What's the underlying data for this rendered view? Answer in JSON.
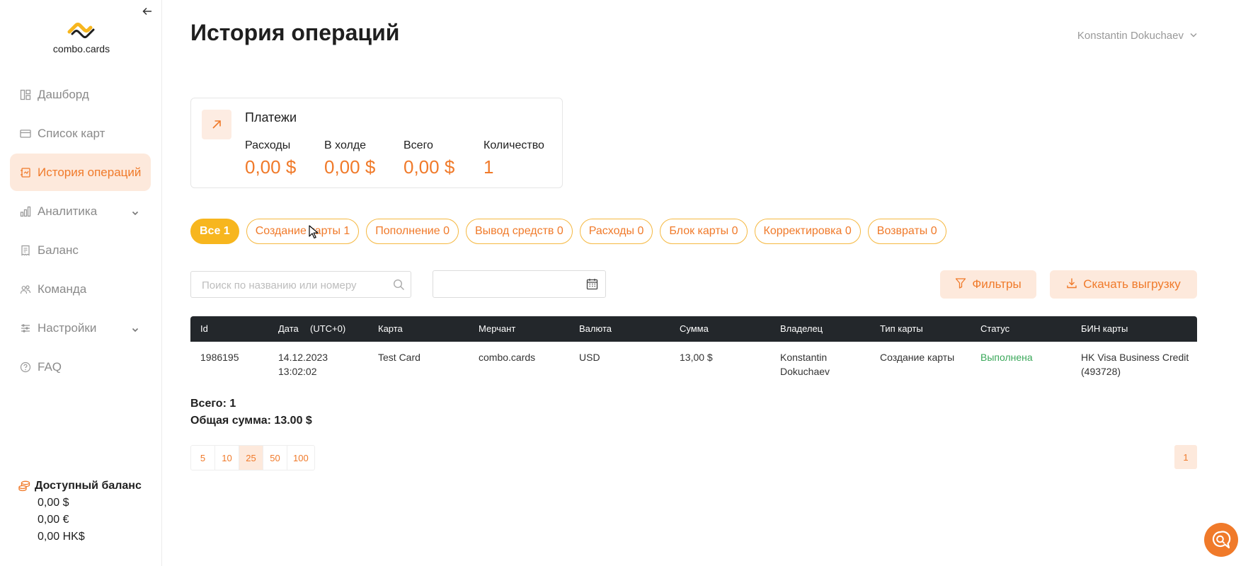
{
  "app": {
    "logo_text": "combo.cards"
  },
  "sidebar": {
    "items": [
      {
        "label": "Дашборд",
        "icon": "dashboard-icon"
      },
      {
        "label": "Список карт",
        "icon": "card-icon"
      },
      {
        "label": "История операций",
        "icon": "history-icon",
        "active": true
      },
      {
        "label": "Аналитика",
        "icon": "analytics-icon",
        "expandable": true
      },
      {
        "label": "Баланс",
        "icon": "receipt-icon"
      },
      {
        "label": "Команда",
        "icon": "team-icon"
      },
      {
        "label": "Настройки",
        "icon": "settings-icon",
        "expandable": true
      },
      {
        "label": "FAQ",
        "icon": "question-icon"
      }
    ],
    "balance": {
      "title": "Доступный баланс",
      "lines": [
        "0,00 $",
        "0,00 €",
        "0,00 HK$"
      ]
    }
  },
  "header": {
    "title": "История операций",
    "user": "Konstantin Dokuchaev"
  },
  "summary_card": {
    "title": "Платежи",
    "stats": [
      {
        "label": "Расходы",
        "value": "0,00 $"
      },
      {
        "label": "В холде",
        "value": "0,00 $"
      },
      {
        "label": "Всего",
        "value": "0,00 $"
      },
      {
        "label": "Количество",
        "value": "1"
      }
    ]
  },
  "filters": {
    "chips": [
      {
        "label": "Все 1",
        "active": true
      },
      {
        "label": "Создание карты 1"
      },
      {
        "label": "Пополнение 0"
      },
      {
        "label": "Вывод средств 0"
      },
      {
        "label": "Расходы 0"
      },
      {
        "label": "Блок карты 0"
      },
      {
        "label": "Корректировка 0"
      },
      {
        "label": "Возвраты 0"
      }
    ],
    "search_placeholder": "Поиск по названию или номеру",
    "filters_button": "Фильтры",
    "export_button": "Скачать выгрузку"
  },
  "table": {
    "columns": [
      "Id",
      "Дата",
      "(UTC+0)",
      "Карта",
      "Мерчант",
      "Валюта",
      "Сумма",
      "Владелец",
      "Тип карты",
      "Статус",
      "БИН карты"
    ],
    "rows": [
      {
        "id": "1986195",
        "date": "14.12.2023",
        "time": "13:02:02",
        "card": "Test Card",
        "merchant": "combo.cards",
        "currency": "USD",
        "amount": "13,00 $",
        "owner_first": "Konstantin",
        "owner_last": "Dokuchaev",
        "type": "Создание карты",
        "status": "Выполнена",
        "bin_name": "HK Visa Business Credit",
        "bin_code": "(493728)"
      }
    ]
  },
  "totals": {
    "count": "Всего: 1",
    "sum": "Общая сумма: 13.00 $"
  },
  "pagination": {
    "page_sizes": [
      "5",
      "10",
      "25",
      "50",
      "100"
    ],
    "active_size": "25",
    "current_page": "1"
  },
  "colors": {
    "accent": "#f07a2a",
    "accent_light": "#fde9dc",
    "chip_active": "#f7b61e",
    "success": "#3aa85a",
    "table_header": "#23272b"
  }
}
